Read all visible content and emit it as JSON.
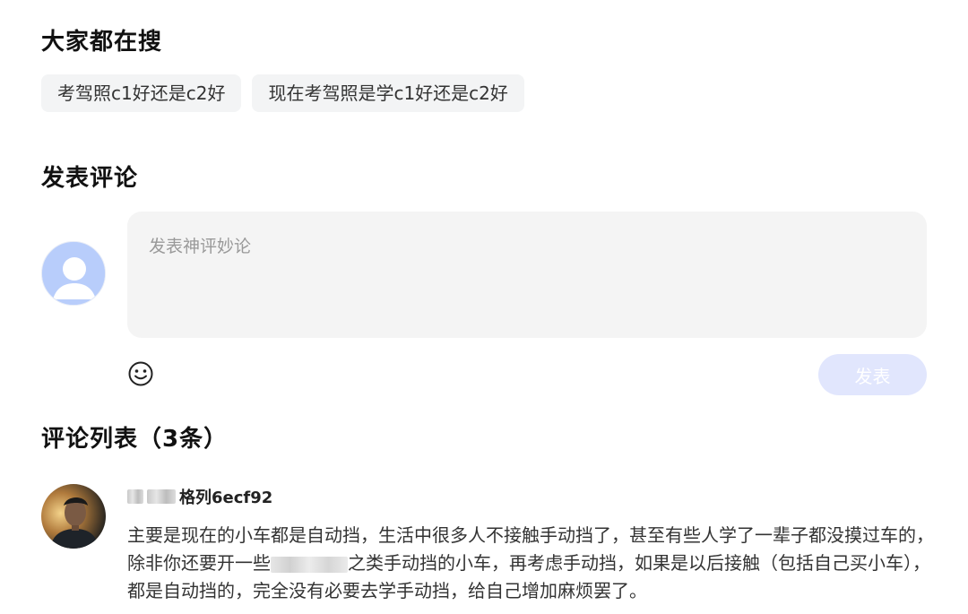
{
  "hot_search": {
    "title": "大家都在搜",
    "tags": [
      "考驾照c1好还是c2好",
      "现在考驾照是学c1好还是c2好"
    ]
  },
  "comment_form": {
    "title": "发表评论",
    "placeholder": "发表神评妙论",
    "submit_label": "发表",
    "emoji_icon": "smiley-face-icon"
  },
  "comment_list": {
    "title": "评论列表（3条）",
    "comments": [
      {
        "username_visible": "格列6ecf92",
        "text_part1": "主要是现在的小车都是自动挡，生活中很多人不接触手动挡了，甚至有些人学了一辈子都没摸过车的，除非你还要开一些",
        "text_part2": "之类手动挡的小车，再考虑手动挡，如果是以后接触（包括自己买小车），都是自动挡的，完全没有必要去学手动挡，给自己增加麻烦罢了。"
      }
    ]
  },
  "colors": {
    "submit_bg": "#e1e6fd",
    "tag_bg": "#f3f4f5",
    "input_bg": "#f4f4f4",
    "avatar_default_bg": "#b8cdfb"
  }
}
